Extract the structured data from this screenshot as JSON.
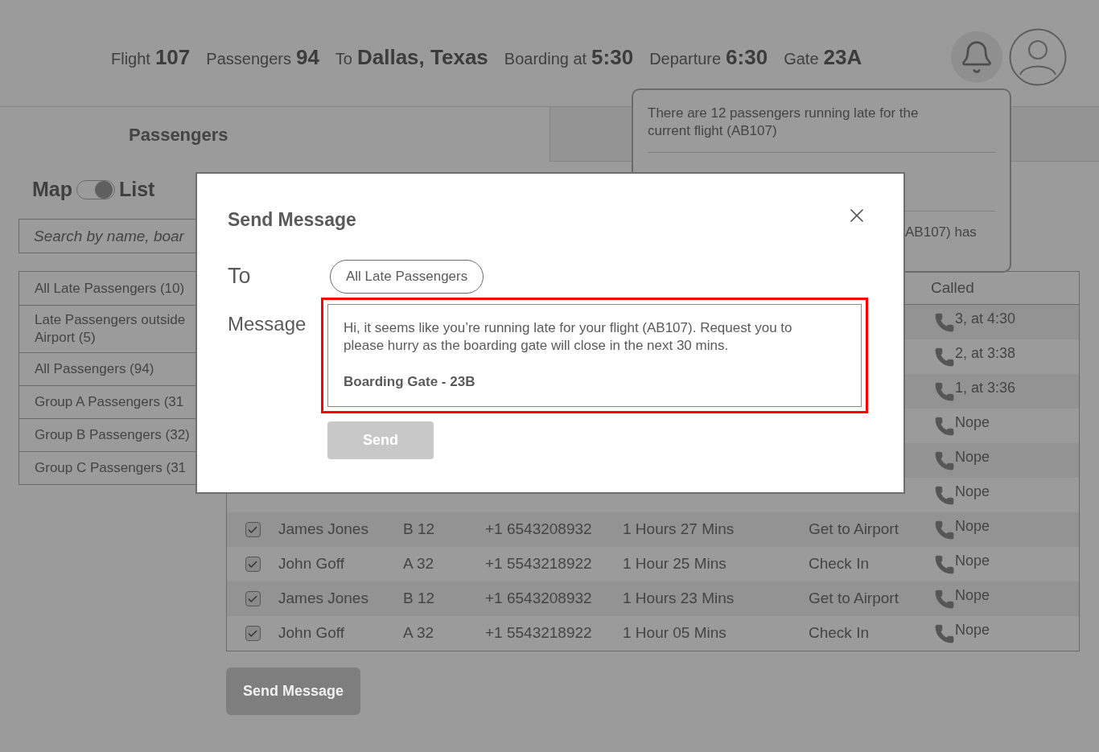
{
  "header": {
    "items": [
      {
        "label": "Flight",
        "value": "107"
      },
      {
        "label": "Passengers",
        "value": "94"
      },
      {
        "label": "To",
        "value": "Dallas, Texas"
      },
      {
        "label": "Boarding at",
        "value": "5:30"
      },
      {
        "label": "Departure",
        "value": "6:30"
      },
      {
        "label": "Gate",
        "value": "23A"
      }
    ]
  },
  "tabs": [
    {
      "label": "Passengers",
      "selected": true
    },
    {
      "selected": false
    }
  ],
  "view_toggle": {
    "left": "Map",
    "right": "List",
    "on": true
  },
  "search": {
    "placeholder": "Search by name, boar"
  },
  "groups": [
    {
      "label": "All Late Passengers (10)"
    },
    {
      "label": "Late Passengers outside\nAirport (5)"
    },
    {
      "label": "All Passengers (94)"
    },
    {
      "label": "Group A Passengers (31"
    },
    {
      "label": "Group B Passengers (32)"
    },
    {
      "label": "Group C Passengers (31"
    }
  ],
  "notifications": [
    "There are 12 passengers running late for the current flight (AB107)",
    "AB107) has"
  ],
  "table": {
    "columns": [
      "Called"
    ],
    "rows": [
      {
        "called": "3, at 4:30"
      },
      {
        "called": "2, at 3:38"
      },
      {
        "called": "1, at 3:36"
      },
      {
        "called": "Nope"
      },
      {
        "called": "Nope"
      },
      {
        "called": "Nope"
      },
      {
        "checked": true,
        "name": "James Jones",
        "seat": "B 12",
        "phone": "+1 6543208932",
        "time": "1 Hours 27 Mins",
        "status": "Get to Airport",
        "called": "Nope"
      },
      {
        "checked": true,
        "name": "John Goff",
        "seat": "A 32",
        "phone": "+1 5543218922",
        "time": "1 Hour 25 Mins",
        "status": "Check In",
        "called": "Nope"
      },
      {
        "checked": true,
        "name": "James Jones",
        "seat": "B 12",
        "phone": "+1 6543208932",
        "time": "1 Hours 23 Mins",
        "status": "Get to Airport",
        "called": "Nope"
      },
      {
        "checked": true,
        "name": "John Goff",
        "seat": "A 32",
        "phone": "+1 5543218922",
        "time": "1 Hour 05 Mins",
        "status": "Check In",
        "called": "Nope"
      }
    ]
  },
  "send_message_button": {
    "label": "Send Message",
    "disabled": true
  },
  "modal": {
    "title": "Send Message",
    "to_label": "To",
    "recipient": "All Late Passengers",
    "message_label": "Message",
    "message": "Hi, it seems like you’re running late for your flight (AB107). Request you to please hurry as the boarding gate will close in the next 30 mins.",
    "message_footer": "Boarding Gate - 23B",
    "highlighted": true,
    "send_button": {
      "label": "Send",
      "disabled": true
    }
  }
}
